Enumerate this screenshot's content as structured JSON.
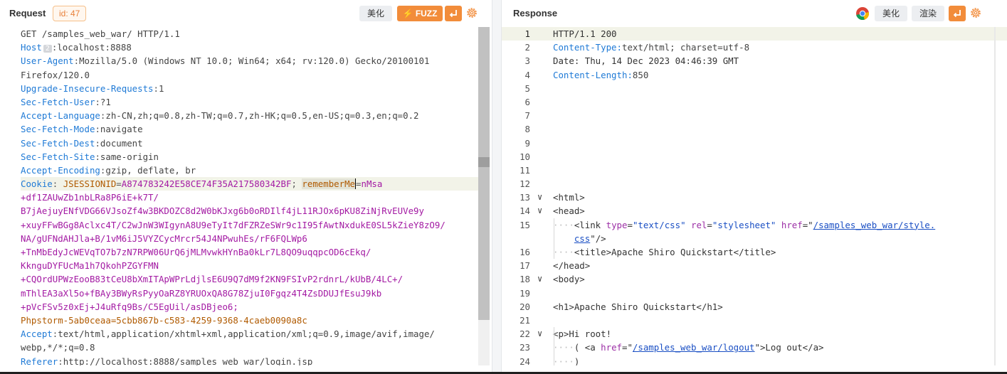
{
  "request": {
    "title": "Request",
    "id_badge": "id: 47",
    "beautify_label": "美化",
    "fuzz_label": "FUZZ",
    "host_badge": "2",
    "cookie_name": "Cookie",
    "cookie_jsession_key": "JSESSIONID",
    "cookie_jsession_value": "A874783242E58CE74F35A217580342BF",
    "cookie_remember_key": "rememberMe",
    "cookie_remember_value_start": "nMsa",
    "cookie_remember_lines": [
      "+df1ZAUwZb1nbLRa8P6iE+k7T/",
      "B7jAejuyENfVDG66VJsoZf4w3BKDOZC8d2W0bKJxg6b0oRDIlf4jL11RJOx6pKU8ZiNjRvEUVe9y",
      "+xuyFFwBGg8Aclxc4T/C2wJnW3WIgynA8U9eTyIt7dFZRZeSWr9c1I95fAwtNxdukE0SL5kZieY8zO9/",
      "NA/gUFNdAHJla+B/1vM6iJ5VYZCycMrcr54J4NPwuhEs/rF6FQLWp6",
      "+TnMbEdyJcWEVqTO7b7zN7RPW06UrQ6jMLMvwkHYnBa0kLr7L8QO9uqqpcOD6cEkq/",
      "KknguDYFUcMa1h7QkohPZGYFMN",
      "+CQOrdUPWzEooB83tCeU8bXmITApWPrLdjlsE6U9Q7dM9f2KN9FSIvP2rdnrL/kUbB/4LC+/",
      "mThlEA3aXl5o+fBAy3BWyRsPyyOaRZ8YRUOxQA8G78ZjuI0Fgqz4T4ZsDDUJfEsuJ9kb",
      "+pVcFSv5z0xEj+J4uRfq9Bs/C5EgUil/asDBjeo6;"
    ],
    "cookie_phpstorm": "Phpstorm-5ab0ceaa=5cbb867b-c583-4259-9368-4caeb0090a8c",
    "lines": [
      {
        "key": "",
        "raw": "GET /samples_web_war/ HTTP/1.1"
      },
      {
        "key": "Host",
        "value": "localhost:8888"
      },
      {
        "key": "User-Agent",
        "value": "Mozilla/5.0 (Windows NT 10.0; Win64; x64; rv:120.0) Gecko/20100101 "
      },
      {
        "key": "",
        "raw": "Firefox/120.0"
      },
      {
        "key": "Upgrade-Insecure-Requests",
        "value": "1"
      },
      {
        "key": "Sec-Fetch-User",
        "value": "?1"
      },
      {
        "key": "Accept-Language",
        "value": "zh-CN,zh;q=0.8,zh-TW;q=0.7,zh-HK;q=0.5,en-US;q=0.3,en;q=0.2"
      },
      {
        "key": "Sec-Fetch-Mode",
        "value": "navigate"
      },
      {
        "key": "Sec-Fetch-Dest",
        "value": "document"
      },
      {
        "key": "Sec-Fetch-Site",
        "value": "same-origin"
      },
      {
        "key": "Accept-Encoding",
        "value": "gzip, deflate, br"
      }
    ],
    "after_cookie_lines": [
      {
        "key": "Accept",
        "value": "text/html,application/xhtml+xml,application/xml;q=0.9,image/avif,image/"
      },
      {
        "key": "",
        "raw": "webp,*/*;q=0.8"
      },
      {
        "key": "Referer",
        "value": "http://localhost:8888/samples_web_war/login.jsp"
      }
    ]
  },
  "response": {
    "title": "Response",
    "beautify_label": "美化",
    "render_label": "渲染",
    "status_line": "HTTP/1.1 200",
    "content_type_key": "Content-Type",
    "content_type_value": "text/html; charset=utf-8",
    "date_line": "Date: Thu, 14 Dec 2023 04:46:39 GMT",
    "content_length_key": "Content-Length",
    "content_length_value": "850",
    "line_numbers": [
      "1",
      "2",
      "3",
      "4",
      "5",
      "6",
      "7",
      "8",
      "9",
      "10",
      "11",
      "12",
      "13",
      "14",
      "15",
      "",
      "16",
      "17",
      "18",
      "19",
      "20",
      "21",
      "22",
      "23",
      "24"
    ],
    "html_open": "<html>",
    "head_open": "<head>",
    "link_tag": "<link",
    "link_type_attr": "type",
    "link_type_val": "\"text/css\"",
    "link_rel_attr": "rel",
    "link_rel_val": "\"stylesheet\"",
    "link_href_attr": "href",
    "link_href_val_a": "/samples_web_war/style.",
    "link_href_val_b": "css",
    "link_close": "/>",
    "title_line": "<title>Apache Shiro Quickstart</title>",
    "head_close": "</head>",
    "body_open": "<body>",
    "h1_line": "<h1>Apache Shiro Quickstart</h1>",
    "p_line": "<p>Hi root!",
    "logout_pre": "( <a",
    "logout_href_attr": "href",
    "logout_href_val": "/samples_web_war/logout",
    "logout_post": ">Log out</a>",
    "line24": ")"
  }
}
